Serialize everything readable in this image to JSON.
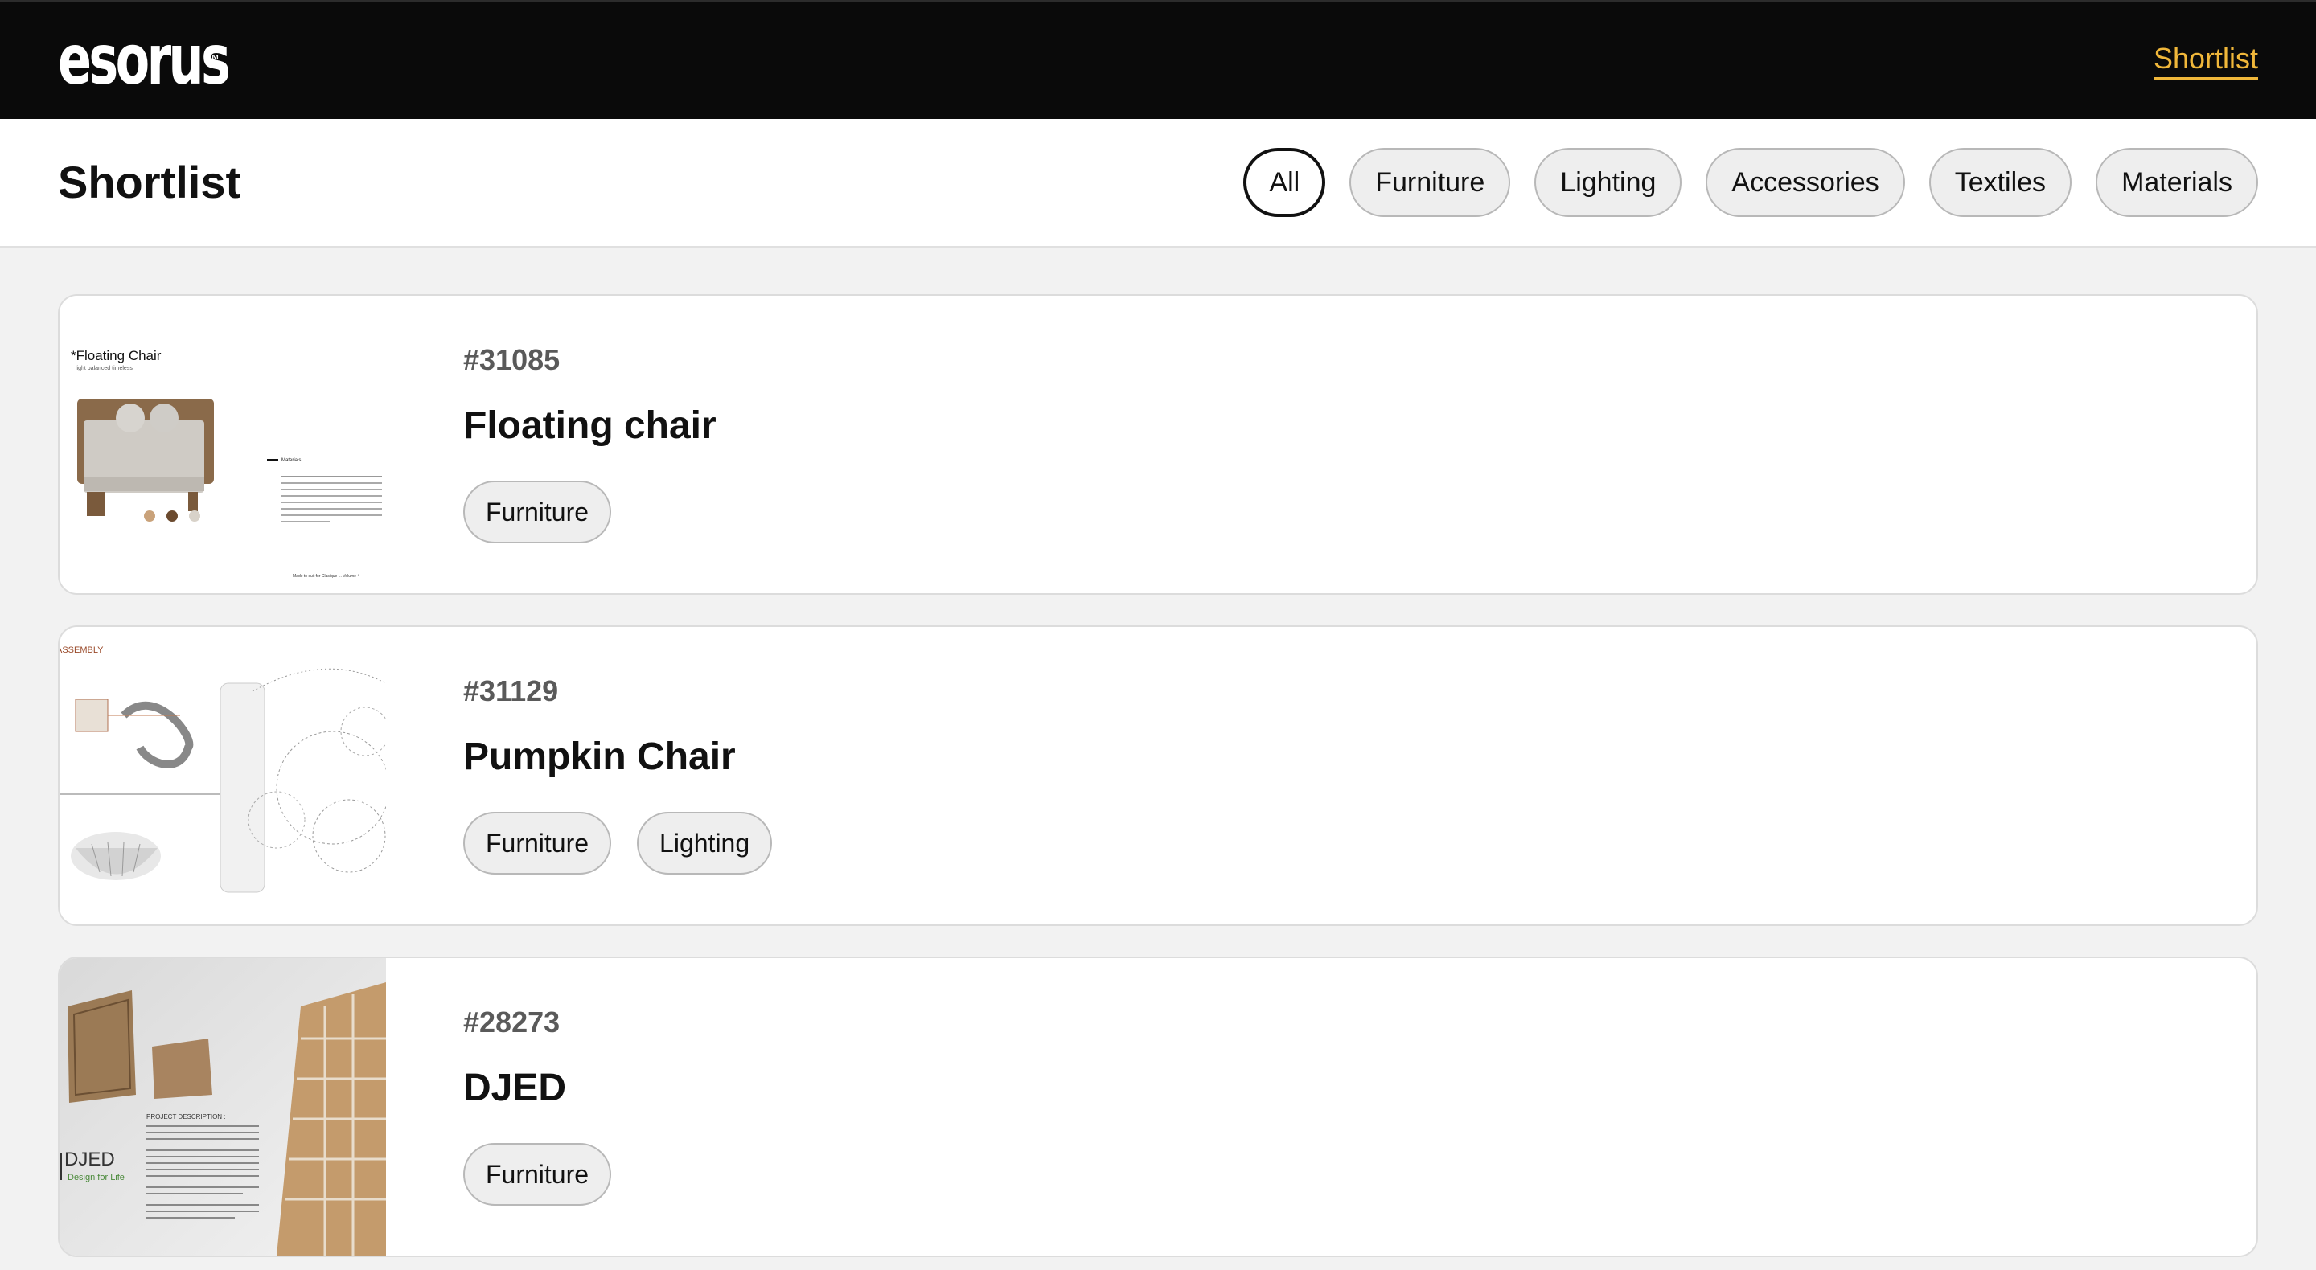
{
  "header": {
    "logo_text": "esorus",
    "logo_tm": "™",
    "nav_link": "Shortlist",
    "accent_color": "#f0b73a"
  },
  "page": {
    "title": "Shortlist",
    "filters": [
      "All",
      "Furniture",
      "Lighting",
      "Accessories",
      "Textiles",
      "Materials"
    ],
    "active_filter": "All"
  },
  "items": [
    {
      "id": "#31085",
      "title": "Floating chair",
      "tags": [
        "Furniture"
      ],
      "thumb": {
        "heading": "*Floating Chair",
        "subheading": "light balanced timeless",
        "section": "Materials",
        "footer": "Made to suit for Clasique ... Volume 4"
      }
    },
    {
      "id": "#31129",
      "title": "Pumpkin Chair",
      "tags": [
        "Furniture",
        "Lighting"
      ],
      "thumb": {
        "heading": "ASSEMBLY"
      }
    },
    {
      "id": "#28273",
      "title": "DJED",
      "tags": [
        "Furniture"
      ],
      "thumb": {
        "brand": "DJED",
        "tagline": "Design for Life",
        "section": "PROJECT DESCRIPTION :"
      }
    }
  ]
}
